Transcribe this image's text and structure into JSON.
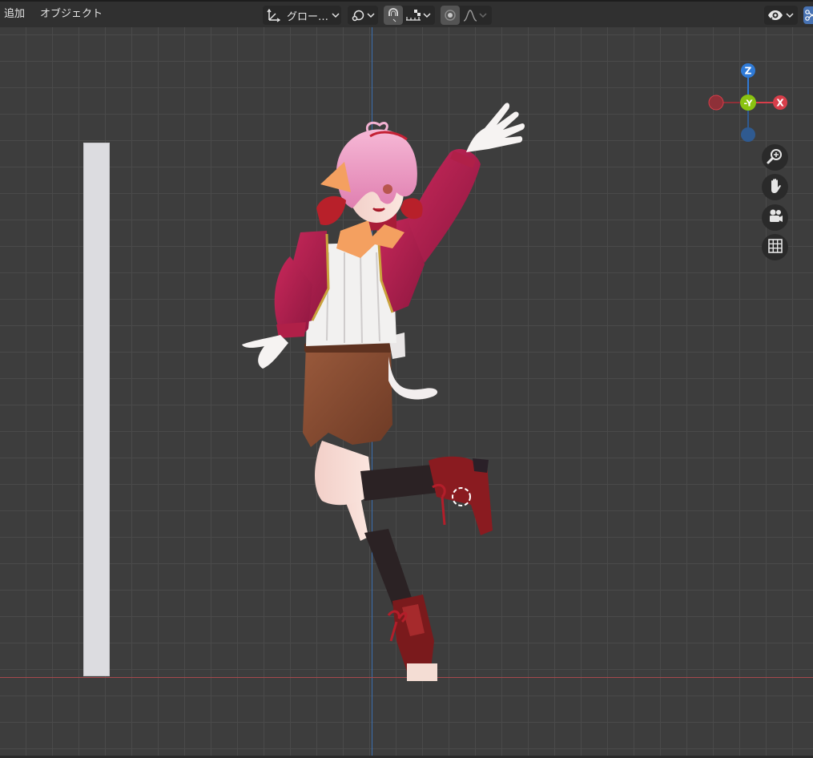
{
  "header": {
    "menu": {
      "add": "追加",
      "object": "オブジェクト"
    },
    "transform_orientation": "グロー…"
  },
  "gizmo": {
    "z": "Z",
    "neg_y": "-Y",
    "x": "X"
  },
  "colors": {
    "header_bg": "#303030",
    "viewport_bg": "#3d3d3d",
    "axis_z": "#3a6fb0",
    "axis_x": "#a5484c",
    "gizmo_x": "#d83e4a",
    "gizmo_y": "#8ac311",
    "gizmo_z": "#2f7ad6"
  },
  "icons": [
    "transform-orientation-icon",
    "pivot-point-icon",
    "snap-magnet-icon",
    "snap-increment-icon",
    "proportional-editing-icon",
    "falloff-curve-icon",
    "visibility-eye-icon",
    "zoom-icon",
    "pan-hand-icon",
    "camera-view-icon",
    "ortho-grid-icon"
  ]
}
